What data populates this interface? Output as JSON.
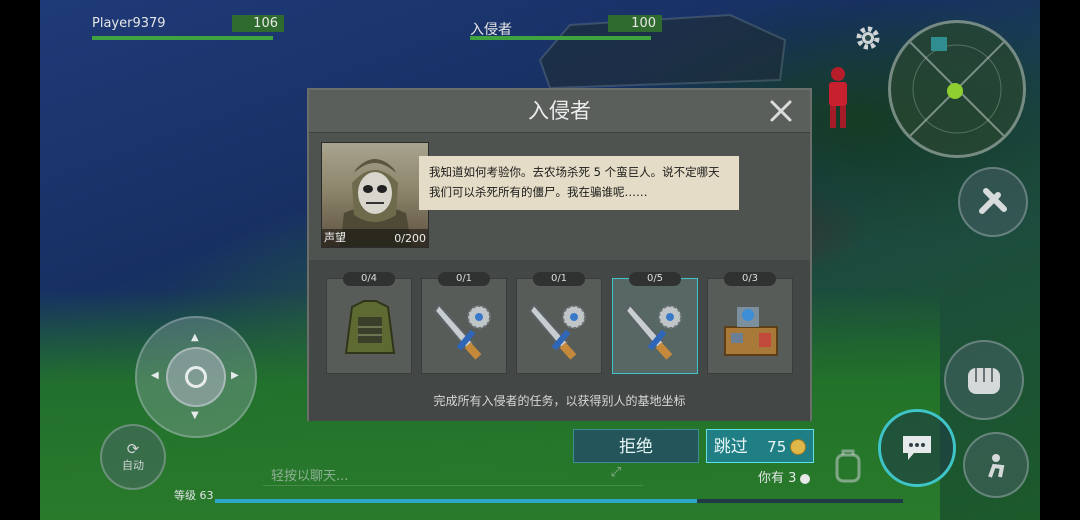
{
  "hud": {
    "player_name": "Player9379",
    "player_hp": "106",
    "enemy_name": "入侵者",
    "enemy_hp": "100"
  },
  "dialog": {
    "title": "入侵者",
    "close_symbol": "✕",
    "speech": "我知道如何考验你。去农场杀死 5 个蛮巨人。说不定哪天我们可以杀死所有的僵尸。我在骗谁呢……",
    "reputation_label": "声望",
    "reputation_value": "0/200",
    "tasks": [
      {
        "count": "0/4",
        "icon": "armor-vest-icon"
      },
      {
        "count": "0/1",
        "icon": "machete-saw-icon"
      },
      {
        "count": "0/1",
        "icon": "machete-saw-icon"
      },
      {
        "count": "0/5",
        "icon": "machete-saw-icon",
        "selected": true
      },
      {
        "count": "0/3",
        "icon": "workbench-icon"
      }
    ],
    "footnote": "完成所有入侵者的任务，以获得别人的基地坐标"
  },
  "actions": {
    "refuse_label": "拒绝",
    "skip_label": "跳过",
    "skip_cost": "75",
    "you_have_label": "你有 3"
  },
  "controls": {
    "auto_label": "自动",
    "chat_placeholder": "轻按以聊天...",
    "level_label": "等级 63",
    "xp_progress": 0.7
  },
  "colors": {
    "hp_bar": "#3fa43f",
    "accent": "#3fc4c8",
    "coin": "#e0b84a"
  }
}
